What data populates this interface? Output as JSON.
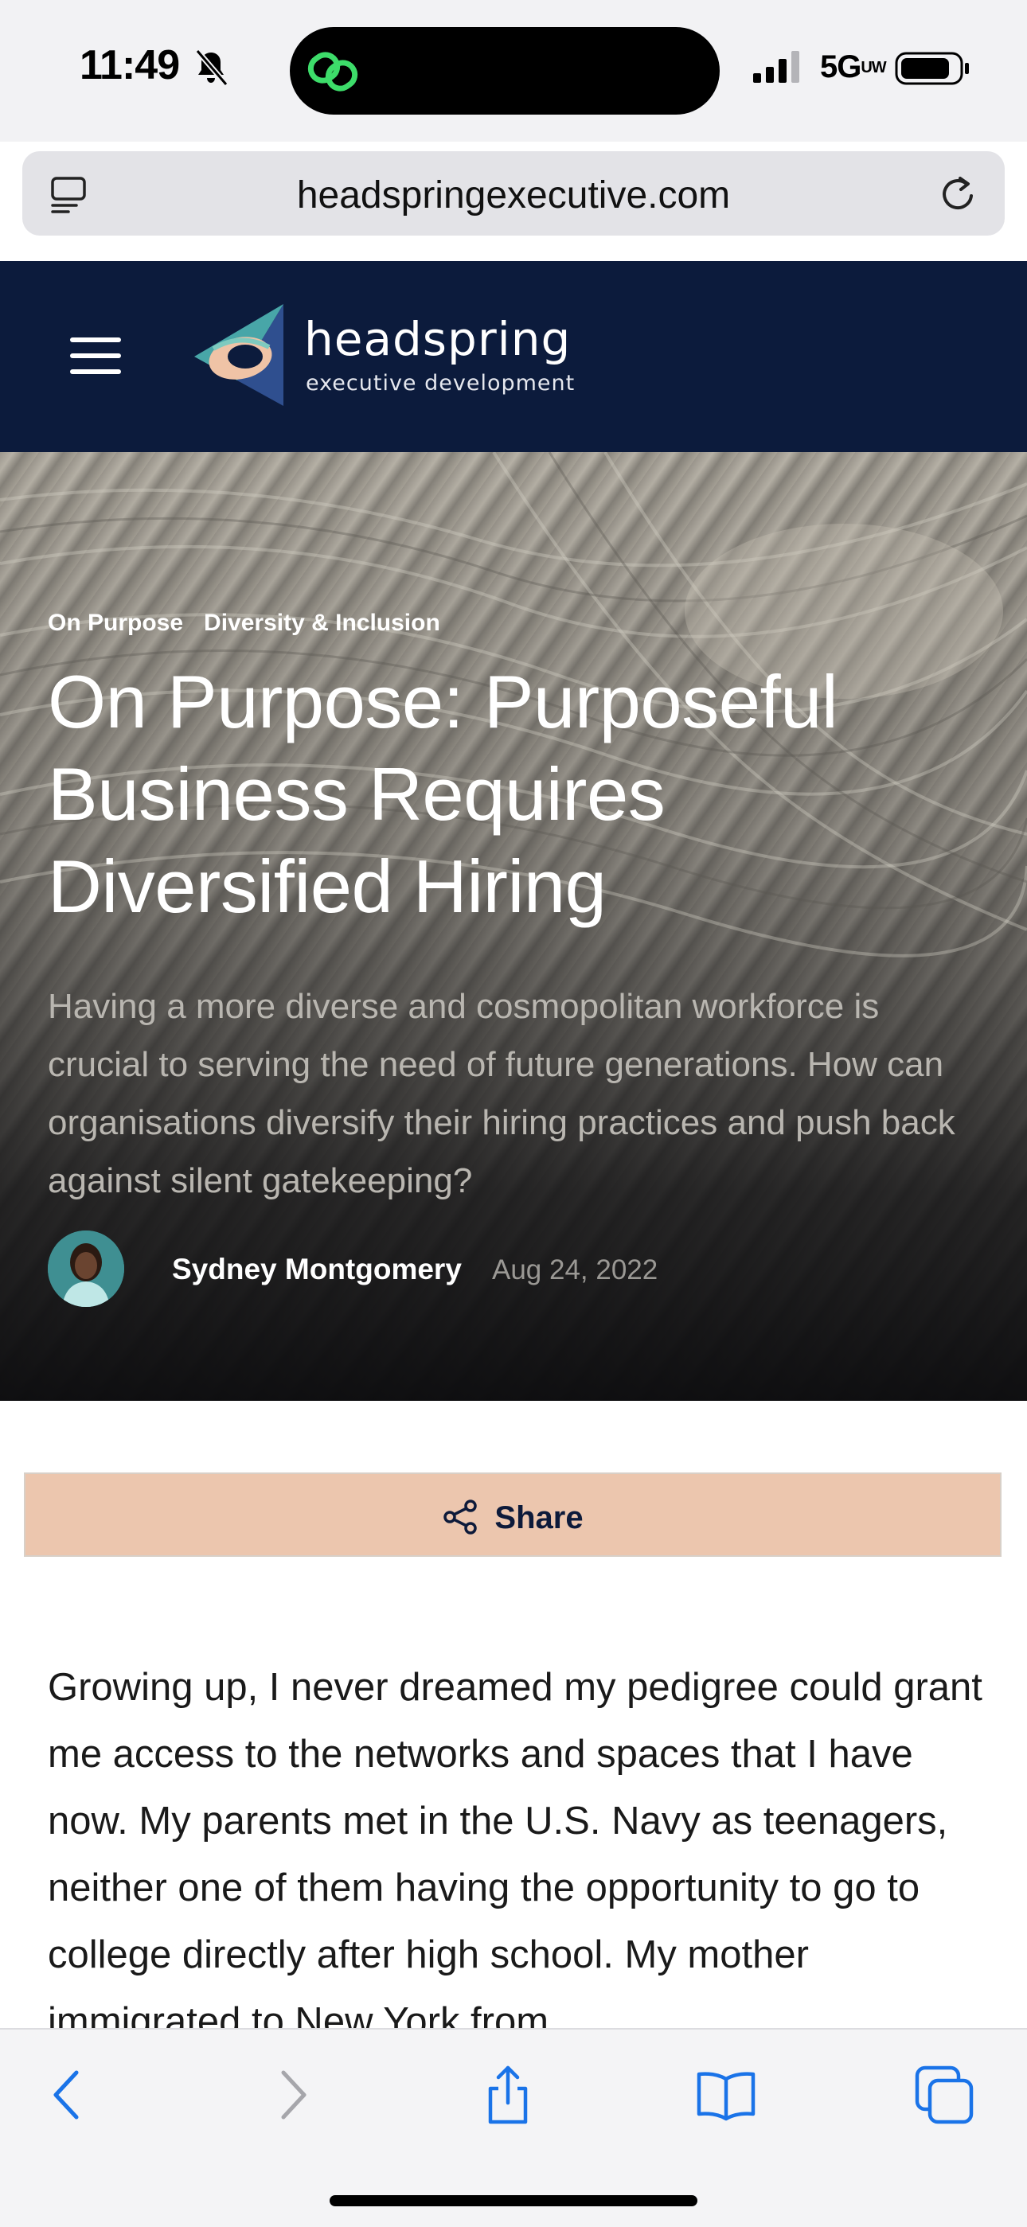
{
  "status_bar": {
    "time": "11:49",
    "network": "5G",
    "network_suffix": "UW",
    "icons": [
      "bell-slash-icon",
      "signal-icon",
      "battery-icon"
    ]
  },
  "browser": {
    "url": "headspringexecutive.com",
    "icons": [
      "reader-icon",
      "reload-icon"
    ]
  },
  "site_header": {
    "brand_name": "headspring",
    "brand_tagline": "executive development",
    "brand_color": "#0c1b3c"
  },
  "hero": {
    "categories": [
      "On Purpose",
      "Diversity & Inclusion"
    ],
    "title": "On Purpose: Purposeful Business Requires Diversified Hiring",
    "subtitle": "Having a more diverse and cosmopolitan workforce is crucial to serving the need of future generations. How can organisations diversify their hiring practices and push back against silent gatekeeping?",
    "author": "Sydney Montgomery",
    "date": "Aug 24, 2022"
  },
  "share": {
    "label": "Share",
    "background": "#ecc6ae"
  },
  "article": {
    "body": "Growing up, I never dreamed my pedigree could grant me access to the networks and spaces that I have now. My parents met in the U.S. Navy as teenagers, neither one of them having the opportunity to go to college directly after high school. My mother immigrated to New York from"
  },
  "toolbar": {
    "buttons": [
      "back-icon",
      "forward-icon",
      "share-icon",
      "bookmarks-icon",
      "tabs-icon"
    ],
    "accent": "#1a73e8"
  }
}
